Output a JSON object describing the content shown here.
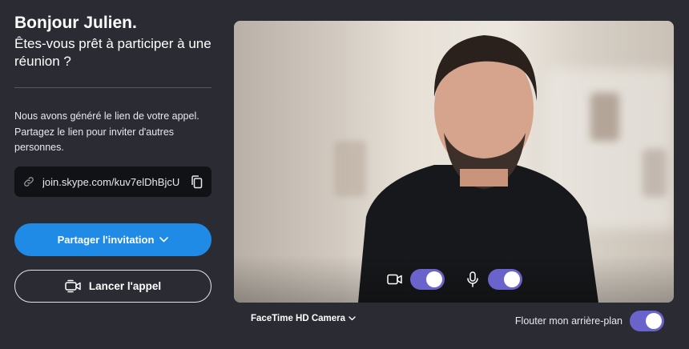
{
  "greeting": "Bonjour Julien.",
  "subtitle": "Êtes-vous prêt à participer à une réunion ?",
  "description": "Nous avons généré le lien de votre appel. Partagez le lien pour inviter d'autres personnes.",
  "meeting_link": {
    "url": "join.skype.com/kuv7elDhBjcU",
    "link_icon": "link-icon",
    "copy_icon": "copy-icon"
  },
  "buttons": {
    "share_invitation": "Partager l'invitation",
    "start_call": "Lancer l'appel"
  },
  "video_controls": {
    "camera_icon": "video-camera-icon",
    "camera_on": true,
    "microphone_icon": "microphone-icon",
    "microphone_on": true
  },
  "camera_select": {
    "selected": "FaceTime HD Camera"
  },
  "background_blur": {
    "label": "Flouter mon arrière-plan",
    "enabled": true
  },
  "colors": {
    "background": "#2b2c33",
    "primary_button": "#1f8be6",
    "toggle_on": "#6a63cc",
    "link_box": "#111216"
  }
}
